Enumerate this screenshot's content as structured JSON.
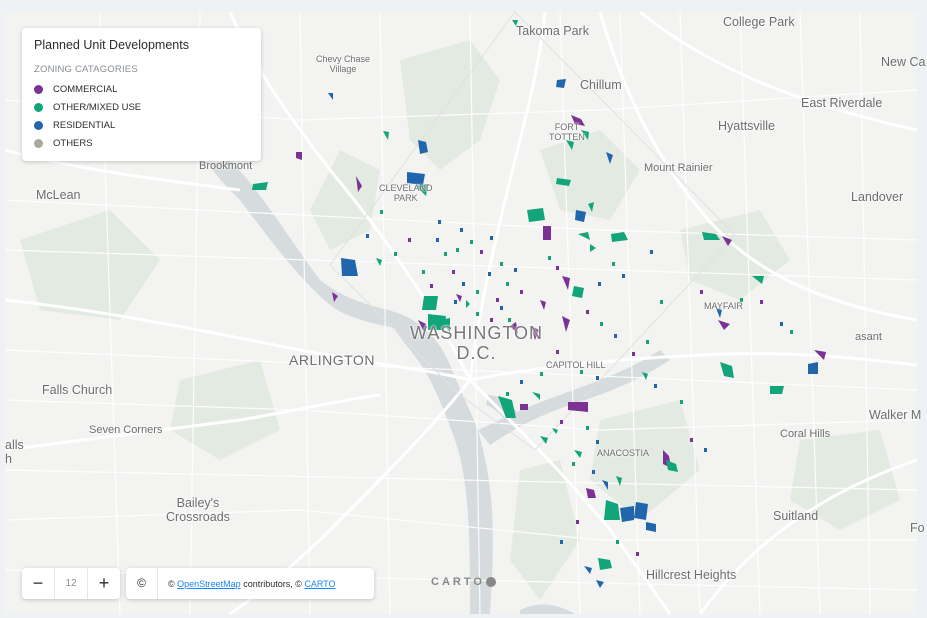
{
  "legend": {
    "title": "Planned Unit Developments",
    "subtitle": "ZONING CATAGORIES",
    "items": [
      {
        "label": "COMMERCIAL",
        "color": "#7b3294"
      },
      {
        "label": "OTHER/MIXED USE",
        "color": "#11a579"
      },
      {
        "label": "RESIDENTIAL",
        "color": "#2166ac"
      },
      {
        "label": "OTHERS",
        "color": "#a5aa99"
      }
    ]
  },
  "zoom": {
    "minus": "−",
    "level": "12",
    "plus": "+"
  },
  "attribution": {
    "toggle": "©",
    "prefix": "© ",
    "osm": "OpenStreetMap",
    "middle": " contributors, © ",
    "carto": "CARTO"
  },
  "logo": "CARTO",
  "places": {
    "college_park": "College Park",
    "takoma_park": "Takoma Park",
    "new_carrollton": "New Ca",
    "chevy_chase_1": "Chevy Chase",
    "chevy_chase_2": "Village",
    "chillum": "Chillum",
    "east_riverdale": "East Riverdale",
    "hyattsville": "Hyattsville",
    "fort_totten_1": "FORT",
    "fort_totten_2": "TOTTEN",
    "brookmont": "Brookmont",
    "mount_rainier": "Mount Rainier",
    "mclean": "McLean",
    "cleveland_1": "CLEVELAND",
    "cleveland_2": "PARK",
    "landover": "Landover",
    "mayfair": "MAYFAIR",
    "washington": "WASHINGTON",
    "dc": "D.C.",
    "pleasant": "asant",
    "arlington": "ARLINGTON",
    "capitol_hill": "CAPITOL HILL",
    "falls_church": "Falls Church",
    "walker_mill": "Walker M",
    "seven_corners": "Seven Corners",
    "coral_hills": "Coral Hills",
    "falls_1": "alls",
    "falls_2": "h",
    "anacostia": "ANACOSTIA",
    "baileys_1": "Bailey's",
    "baileys_2": "Crossroads",
    "suitland": "Suitland",
    "fo": "Fo",
    "hillcrest": "Hillcrest Heights"
  },
  "colors": {
    "commercial": "#7b3294",
    "other_mixed": "#11a579",
    "residential": "#2166ac",
    "others": "#a5aa99",
    "water": "#d4dadc",
    "land": "#f2f3f1",
    "park": "#e2e9e0"
  }
}
